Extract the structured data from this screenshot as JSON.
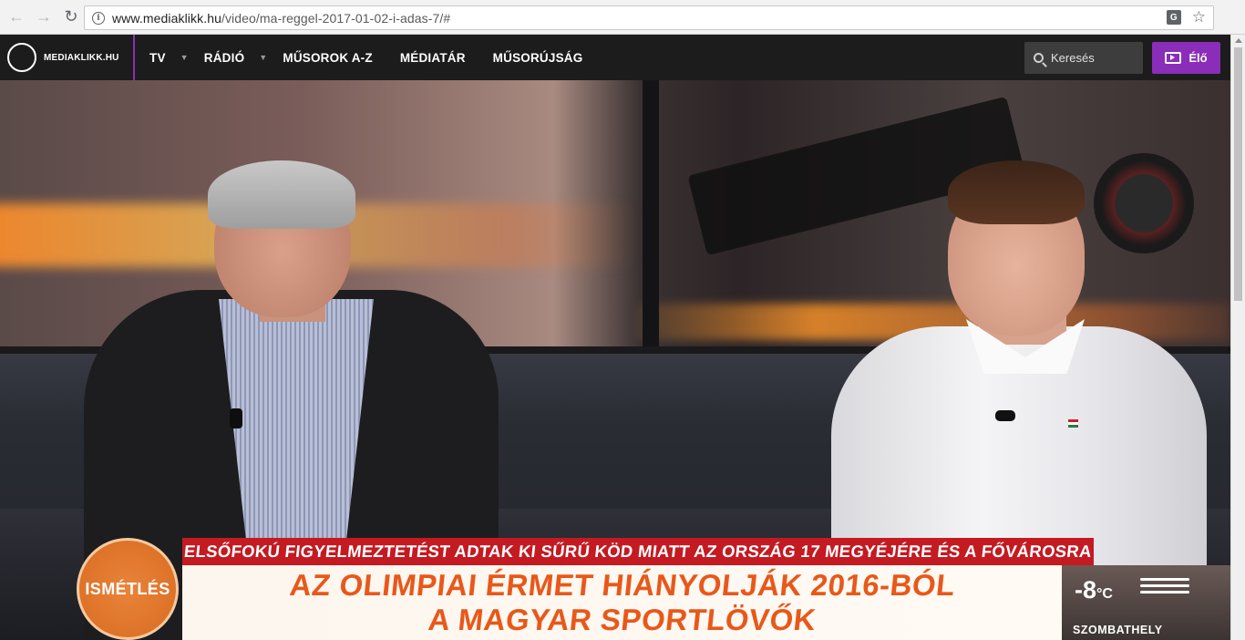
{
  "browser": {
    "back_glyph": "←",
    "forward_glyph": "→",
    "reload_glyph": "↻",
    "info_glyph": "i",
    "url_host": "www.mediaklikk.hu",
    "url_path": "/video/ma-reggel-2017-01-02-i-adas-7/#",
    "translate_glyph": "G",
    "star_glyph": "☆"
  },
  "header": {
    "logo_text": "MEDIAKLIKK.HU",
    "menu": [
      {
        "label": "TV",
        "has_dropdown": true
      },
      {
        "label": "RÁDIÓ",
        "has_dropdown": true
      },
      {
        "label": "MŰSOROK A-Z",
        "has_dropdown": false
      },
      {
        "label": "MÉDIATÁR",
        "has_dropdown": false
      },
      {
        "label": "MŰSORÚJSÁG",
        "has_dropdown": false
      }
    ],
    "caret_glyph": "▼",
    "search_placeholder": "Keresés",
    "live_label": "Élő",
    "accent_color": "#8a2db8"
  },
  "video": {
    "ticker": "ELSŐFOKÚ FIGYELMEZTETÉST ADTAK KI SŰRŰ KÖD MIATT AZ ORSZÁG 17 MEGYÉJÉRE ÉS A FŐVÁROSRA",
    "headline_line1": "AZ OLIMPIAI ÉRMET HIÁNYOLJÁK 2016-BÓL",
    "headline_line2": "A MAGYAR SPORTLÖVŐK",
    "replay_badge": "ISMÉTLÉS",
    "temperature": "-8",
    "temp_unit": "°C",
    "city": "SZOMBATHELY",
    "ticker_color": "#c41a22",
    "headline_color": "#e8581a"
  }
}
